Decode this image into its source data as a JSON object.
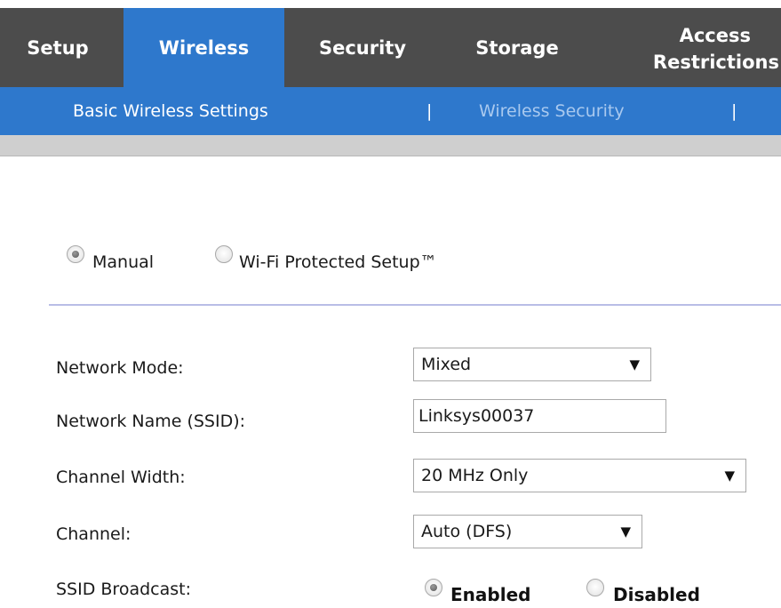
{
  "main_nav": {
    "tabs": [
      {
        "label": "Setup"
      },
      {
        "label": "Wireless",
        "active": true
      },
      {
        "label": "Security"
      },
      {
        "label": "Storage"
      },
      {
        "label_line1": "Access",
        "label_line2": "Restrictions"
      }
    ]
  },
  "sub_nav": {
    "items": [
      {
        "label": "Basic Wireless Settings",
        "current": true
      },
      {
        "label": "Wireless Security",
        "current": false
      }
    ],
    "separator": "|"
  },
  "setup_mode": {
    "manual_label": "Manual",
    "wps_label": "Wi-Fi Protected Setup™",
    "selected": "Manual"
  },
  "form": {
    "network_mode": {
      "label": "Network Mode:",
      "value": "Mixed"
    },
    "network_name": {
      "label": "Network Name (SSID):",
      "value": "Linksys00037"
    },
    "channel_width": {
      "label": "Channel Width:",
      "value": "20 MHz Only"
    },
    "channel": {
      "label": "Channel:",
      "value": "Auto (DFS)"
    },
    "ssid_broadcast": {
      "label": "SSID Broadcast:",
      "enabled_label": "Enabled",
      "disabled_label": "Disabled",
      "selected": "Enabled"
    }
  },
  "icons": {
    "dropdown": "chevron-down-icon",
    "radio_checked": "radio-checked-icon",
    "radio_unchecked": "radio-unchecked-icon"
  },
  "colors": {
    "nav_bg": "#4c4c4c",
    "accent_blue": "#2e78cc",
    "inactive_subnav_text": "#a9c9ef",
    "divider": "#b9bde6"
  }
}
